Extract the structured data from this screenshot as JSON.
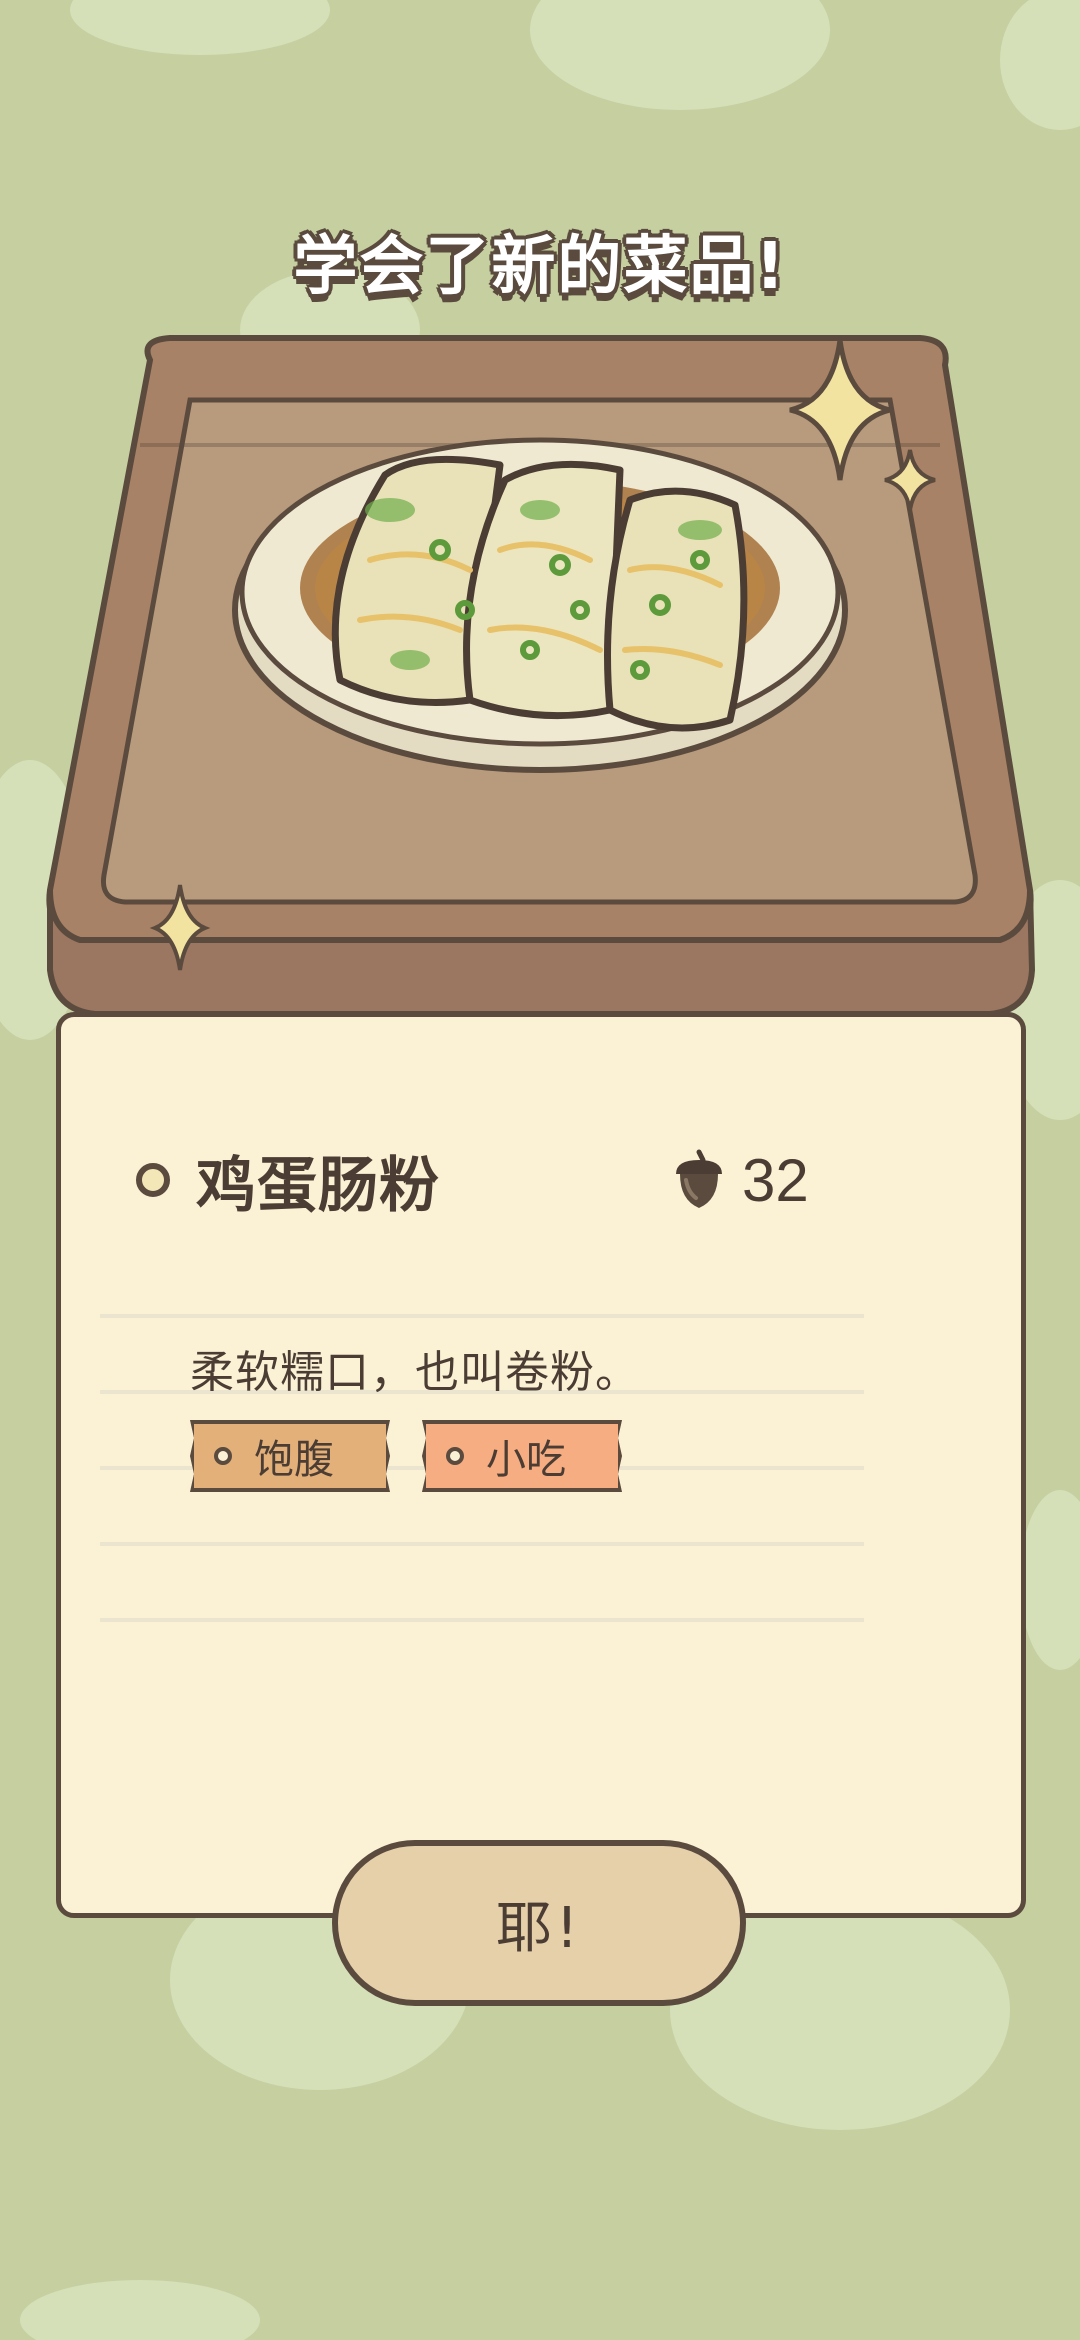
{
  "popup": {
    "title": "学会了新的菜品!",
    "dish_name": "鸡蛋肠粉",
    "price_icon": "acorn-icon",
    "price": "32",
    "description": "柔软糯口，也叫卷粉。",
    "tags": [
      {
        "label": "饱腹",
        "color": "#e3b07a"
      },
      {
        "label": "小吃",
        "color": "#f7ad82"
      }
    ],
    "confirm_label": "耶!"
  },
  "colors": {
    "background": "#c5cfa0",
    "card": "#fbf2d6",
    "outline": "#5b4b3e",
    "tray": "#a88266",
    "button": "#e5d0aa"
  }
}
